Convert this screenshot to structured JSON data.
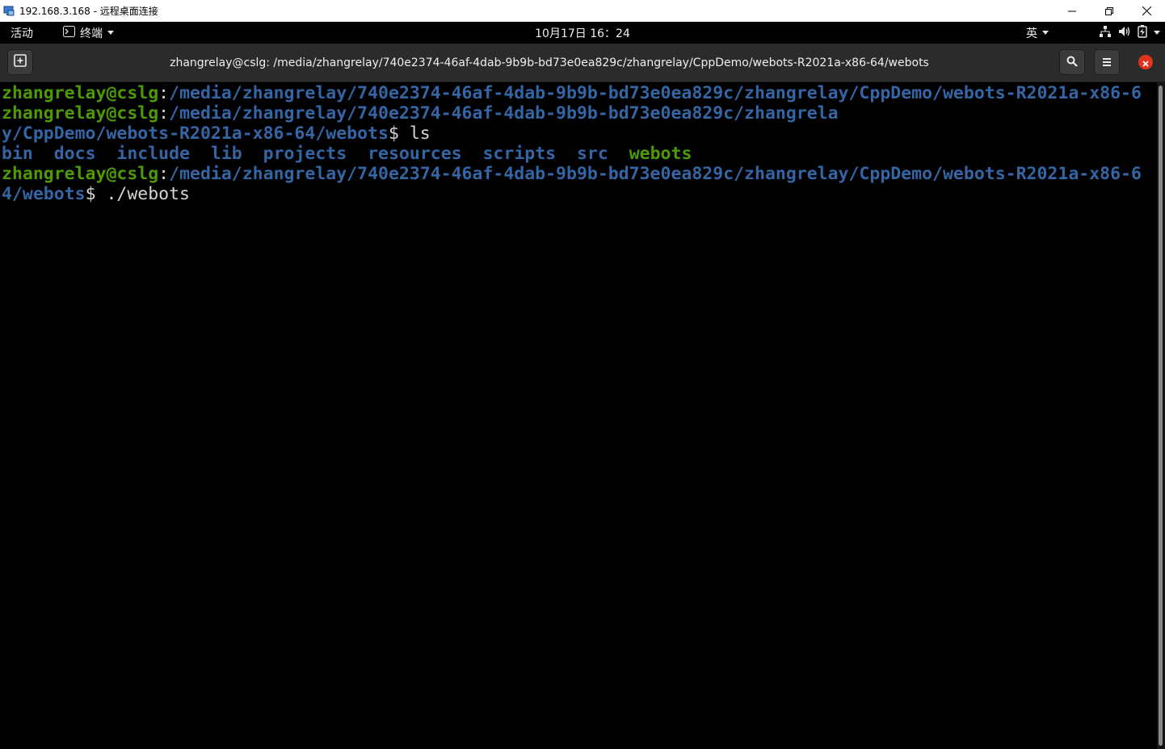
{
  "rdp": {
    "title": "192.168.3.168 - 远程桌面连接"
  },
  "gnome": {
    "activities": "活动",
    "app_menu": "终端",
    "clock": "10月17日 16：24",
    "ime": "英"
  },
  "terminal": {
    "title": "zhangrelay@cslg: /media/zhangrelay/740e2374-46af-4dab-9b9b-bd73e0ea829c/zhangrelay/CppDemo/webots-R2021a-x86-64/webots",
    "lines": [
      {
        "user": "zhangrelay@cslg",
        "sep": ":",
        "path": "/media/zhangrelay/740e2374-46af-4dab-9b9b-bd73e0ea829c/zhangrelay/CppDemo/webots-R2021a-x86-6"
      },
      {
        "user": "zhangrelay@cslg",
        "sep": ":",
        "path": "/media/zhangrelay/740e2374-46af-4dab-9b9b-bd73e0ea829c/zhangrela"
      },
      {
        "path": "y/CppDemo/webots-R2021a-x86-64/webots",
        "prompt": "$ ",
        "cmd": "ls"
      },
      {
        "path": "4/webots",
        "prompt": "$ ",
        "cmd": "./webots"
      }
    ],
    "ls_output": {
      "dirs": [
        "bin",
        "docs",
        "include",
        "lib",
        "projects",
        "resources",
        "scripts",
        "src"
      ],
      "exec": "webots"
    },
    "line5": {
      "user": "zhangrelay@cslg",
      "sep": ":",
      "path": "/media/zhangrelay/740e2374-46af-4dab-9b9b-bd73e0ea829c/zhangrelay/CppDemo/webots-R2021a-x86-6"
    }
  },
  "colors": {
    "prompt_user": "#4e9a06",
    "prompt_path": "#3465a4",
    "text": "#d3d7cf",
    "close": "#e0331b"
  },
  "icons": [
    "rdp-app-icon",
    "minimize-icon",
    "restore-icon",
    "close-icon",
    "terminal-icon",
    "network-icon",
    "volume-icon",
    "battery-icon",
    "new-tab-icon",
    "search-icon",
    "hamburger-menu-icon",
    "window-close-icon"
  ]
}
